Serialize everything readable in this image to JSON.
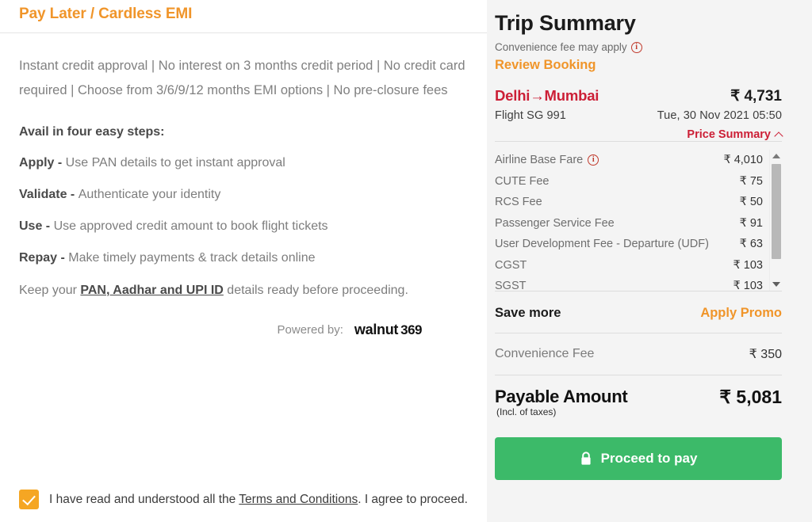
{
  "left": {
    "title": "Pay Later / Cardless EMI",
    "intro": "Instant credit approval | No interest on 3 months credit period | No credit card required | Choose from 3/6/9/12 months EMI options | No pre-closure fees",
    "steps_heading": "Avail in four easy steps:",
    "steps": [
      {
        "key": "Apply - ",
        "text": "Use PAN details to get instant approval"
      },
      {
        "key": "Validate - ",
        "text": "Authenticate your identity"
      },
      {
        "key": "Use - ",
        "text": "Use approved credit amount to book flight tickets"
      },
      {
        "key": "Repay - ",
        "text": "Make timely payments & track details online"
      }
    ],
    "keep_prefix": "Keep your ",
    "keep_link": "PAN, Aadhar and UPI ID",
    "keep_suffix": " details ready before proceeding.",
    "powered_by_label": "Powered by:",
    "powered_by_brand": "walnut",
    "powered_by_brand_suffix": "369",
    "terms_prefix": "I have read and understood all the ",
    "terms_link": "Terms and Conditions",
    "terms_suffix": ". I agree to proceed.",
    "checkbox_checked": true
  },
  "summary": {
    "title": "Trip Summary",
    "convenience_note": "Convenience fee may apply",
    "review_booking": "Review Booking",
    "route": "Delhi→Mumbai",
    "route_price": "₹ 4,731",
    "flight_label": "Flight  SG 991",
    "flight_datetime": "Tue, 30 Nov 2021 05:50",
    "price_summary_toggle": "Price Summary",
    "breakdown": [
      {
        "label": "Airline Base Fare",
        "value": "₹ 4,010",
        "info": true
      },
      {
        "label": "CUTE Fee",
        "value": "₹ 75",
        "info": false
      },
      {
        "label": "RCS Fee",
        "value": "₹ 50",
        "info": false
      },
      {
        "label": "Passenger Service Fee",
        "value": "₹ 91",
        "info": false
      },
      {
        "label": "User Development Fee - Departure (UDF)",
        "value": "₹ 63",
        "info": false
      },
      {
        "label": "CGST",
        "value": "₹ 103",
        "info": false
      },
      {
        "label": "SGST",
        "value": "₹ 103",
        "info": false
      }
    ],
    "save_more_label": "Save more",
    "apply_promo_label": "Apply Promo",
    "convenience_fee_label": "Convenience Fee",
    "convenience_fee_value": "₹ 350",
    "payable_label": "Payable Amount",
    "payable_sub": "(Incl. of taxes)",
    "payable_value": "₹ 5,081",
    "pay_button_label": "Proceed to pay"
  },
  "colors": {
    "accent_orange": "#f0952a",
    "brand_red": "#cc1f36",
    "pay_green": "#3cba69",
    "panel_bg": "#f4f4f4"
  }
}
